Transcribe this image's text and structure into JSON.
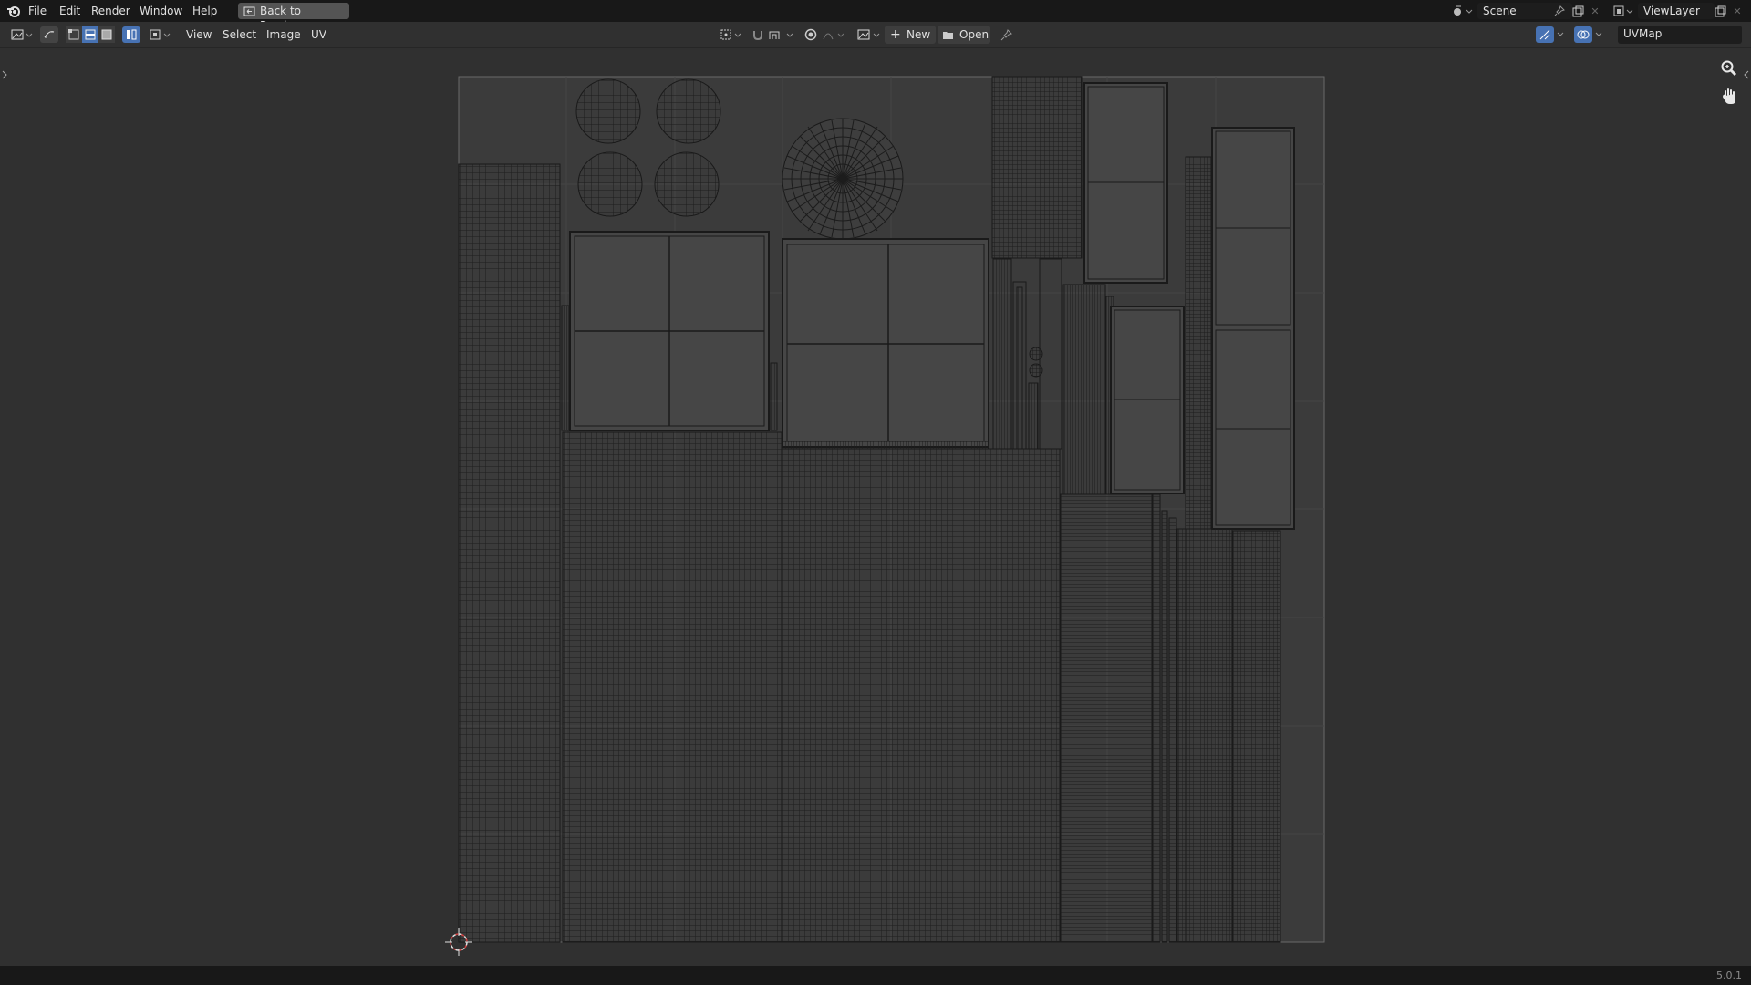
{
  "app": {
    "menus": [
      "File",
      "Edit",
      "Render",
      "Window",
      "Help"
    ],
    "back_button": "Back to Previous",
    "scene_name": "Scene",
    "view_layer": "ViewLayer"
  },
  "header": {
    "menus": [
      "View",
      "Select",
      "Image",
      "UV"
    ],
    "new_label": "New",
    "open_label": "Open",
    "uv_map": "UVMap"
  },
  "icons": {
    "app_logo": "blender-logo-icon",
    "editor_type": "image-editor-icon",
    "sync": "uv-sync-select-icon",
    "pivot": "pivot-point-icon",
    "snap": "snap-magnet-icon",
    "proportional": "proportional-edit-icon",
    "zoom": "zoom-icon",
    "pan": "hand-pan-icon"
  },
  "colors": {
    "accent": "#4772b3",
    "wire": "#1a1a1a",
    "island_fill": "#474747",
    "bounds": "#6a6a6a"
  },
  "status": {
    "version": "5.0.1"
  }
}
